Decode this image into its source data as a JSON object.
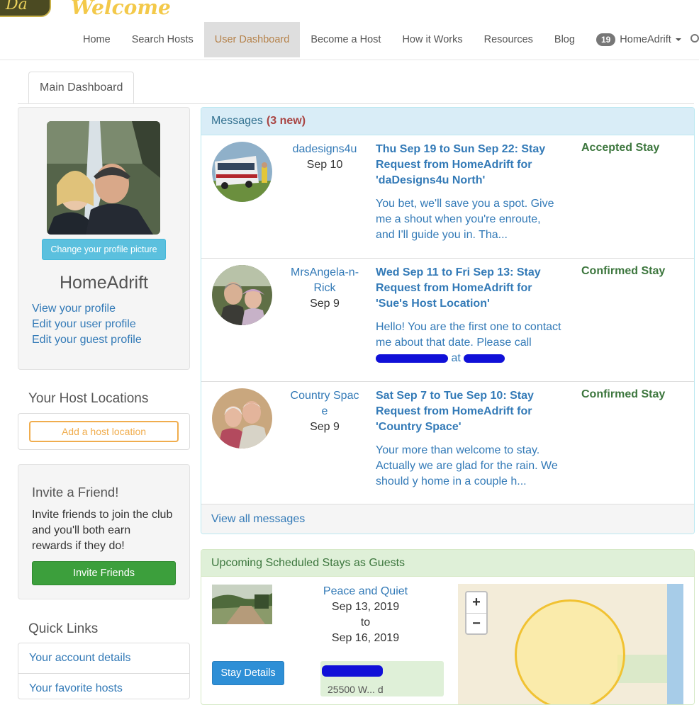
{
  "header": {
    "logo_text": "Da",
    "welcome": "Welcome",
    "nav": [
      {
        "label": "Home"
      },
      {
        "label": "Search Hosts"
      },
      {
        "label": "User Dashboard",
        "active": true
      },
      {
        "label": "Become a Host"
      },
      {
        "label": "How it Works"
      },
      {
        "label": "Resources"
      },
      {
        "label": "Blog"
      }
    ],
    "user": {
      "badge": "19",
      "name": "HomeAdrift"
    }
  },
  "tabs": {
    "main": "Main Dashboard"
  },
  "profile": {
    "change_picture": "Change your profile picture",
    "name": "HomeAdrift",
    "links": [
      "View your profile",
      "Edit your user profile",
      "Edit your guest profile"
    ]
  },
  "host_locations": {
    "title": "Your Host Locations",
    "add_button": "Add a host location"
  },
  "invite": {
    "title": "Invite a Friend!",
    "text": "Invite friends to join the club and you'll both earn rewards if they do!",
    "button": "Invite Friends"
  },
  "quick_links": {
    "title": "Quick Links",
    "items": [
      "Your account details",
      "Your favorite hosts"
    ]
  },
  "messages": {
    "title": "Messages",
    "new_count": "(3 new)",
    "items": [
      {
        "sender": "dadesigns4u",
        "date": "Sep 10",
        "subject": "Thu Sep 19 to Sun Sep 22: Stay Request from HomeAdrift for 'daDesigns4u North'",
        "body": "You bet, we'll save you a spot. Give me a shout when you're enroute, and I'll guide you in. Tha...",
        "status": "Accepted Stay"
      },
      {
        "sender": "MrsAngela-n-Rick",
        "date": "Sep 9",
        "subject": "Wed Sep 11 to Fri Sep 13: Stay Request from HomeAdrift for 'Sue's Host Location'",
        "body_a": "Hello! You are the first one to contact me about that date. Please call",
        "body_b": "at",
        "status": "Confirmed Stay"
      },
      {
        "sender": "Country Space",
        "date": "Sep 9",
        "subject": "Sat Sep 7 to Tue Sep 10: Stay Request from HomeAdrift for 'Country Space'",
        "body": "Your more than welcome to stay. Actually we are glad for the rain. We should y home in a couple h...",
        "status": "Confirmed Stay"
      }
    ],
    "view_all": "View all messages"
  },
  "stays": {
    "title": "Upcoming Scheduled Stays as Guests",
    "item": {
      "name": "Peace and Quiet",
      "from": "Sep 13, 2019",
      "to_word": "to",
      "to": "Sep 16, 2019",
      "button": "Stay Details",
      "address": "25500 W...  d"
    },
    "map": {
      "zoom_in": "+",
      "zoom_out": "−"
    }
  }
}
